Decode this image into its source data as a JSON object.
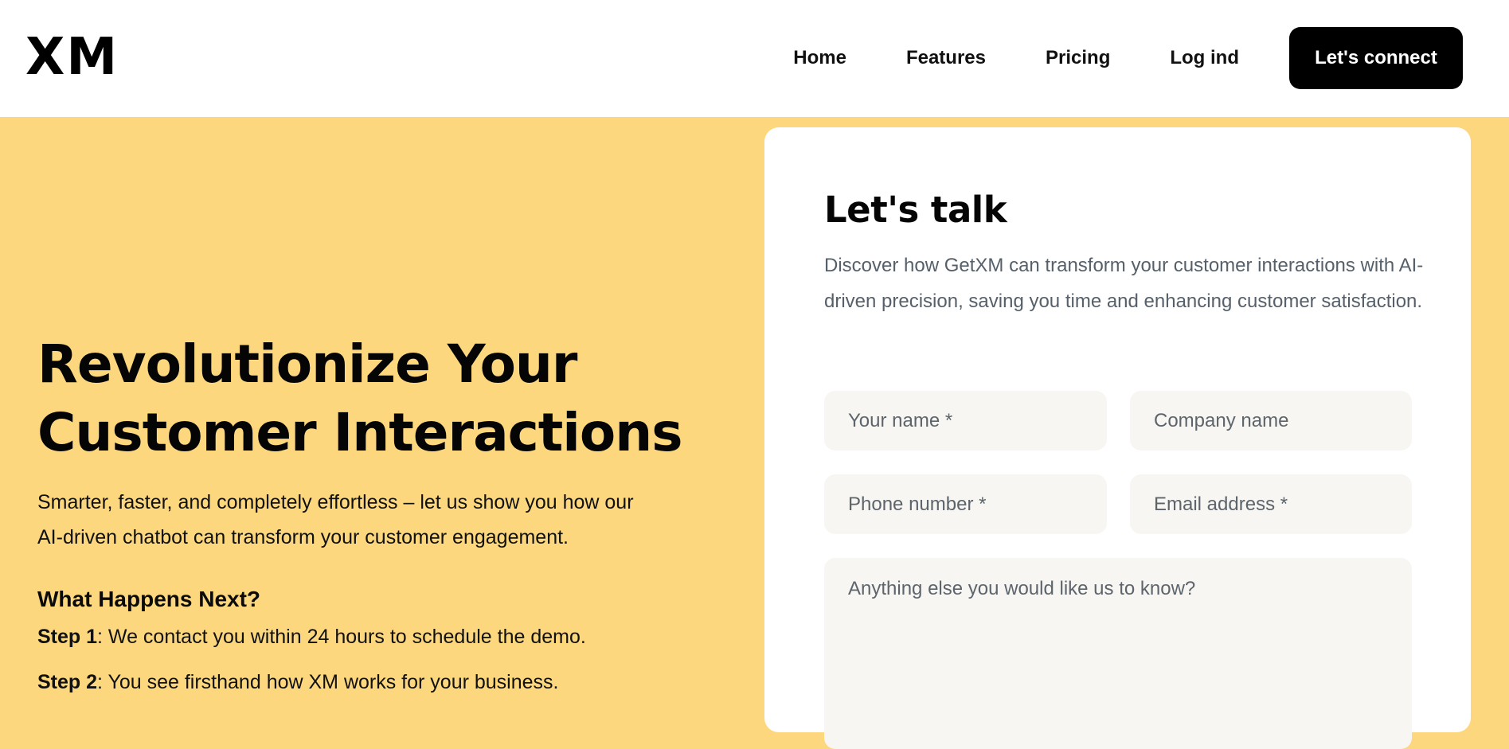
{
  "header": {
    "logo": "XM",
    "nav": [
      "Home",
      "Features",
      "Pricing",
      "Log ind"
    ],
    "cta": "Let's connect"
  },
  "hero": {
    "title_line1": "Revolutionize Your",
    "title_line2": "Customer Interactions",
    "subtitle": "Smarter, faster, and completely effortless – let us show you how our AI-driven chatbot can transform your customer engagement.",
    "next_title": "What Happens Next?",
    "steps": [
      {
        "label": "Step 1",
        "text": ": We contact you within 24 hours to schedule the demo."
      },
      {
        "label": "Step 2",
        "text": ": You see firsthand how XM works for your business."
      }
    ]
  },
  "form": {
    "title": "Let's talk",
    "description": "Discover how GetXM can transform your customer interactions with AI-driven precision, saving you time and enhancing customer satisfaction.",
    "name_placeholder": "Your name *",
    "company_placeholder": "Company name",
    "phone_placeholder": "Phone number *",
    "email_placeholder": "Email address *",
    "message_placeholder": "Anything else you would like us to know?"
  },
  "colors": {
    "background": "#fcd77e",
    "header": "#ffffff",
    "cta": "#000000",
    "field": "#f7f6f2",
    "muted_text": "#56606a"
  }
}
